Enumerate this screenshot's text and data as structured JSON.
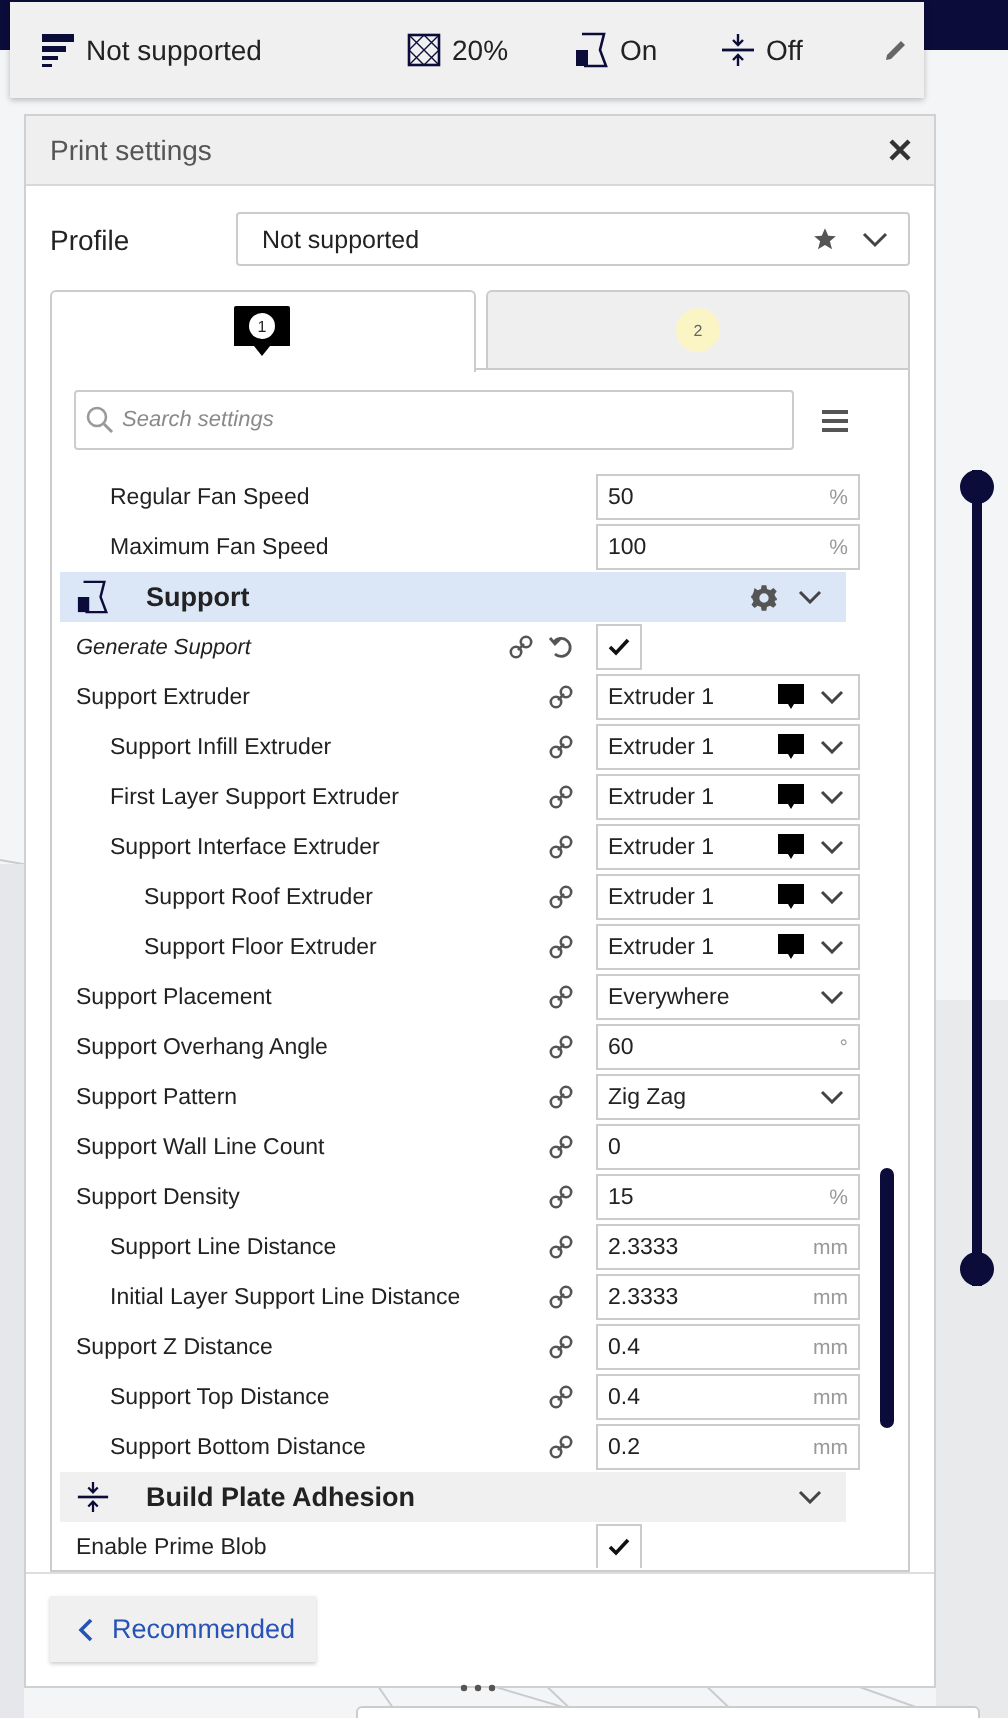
{
  "header": {
    "items": [
      {
        "kind": "profile",
        "label": "Not supported"
      },
      {
        "kind": "infill",
        "label": "20%"
      },
      {
        "kind": "support",
        "label": "On"
      },
      {
        "kind": "adhesion",
        "label": "Off"
      }
    ]
  },
  "print_settings": {
    "title": "Print settings",
    "profile": {
      "label": "Profile",
      "value": "Not supported"
    },
    "tabs": [
      {
        "label": "1",
        "selected": true,
        "color": "#000000"
      },
      {
        "label": "2",
        "selected": false,
        "color": "#fbf5c6"
      }
    ],
    "search": {
      "placeholder": "Search settings"
    },
    "continued_rows": [
      {
        "label": "Regular Fan Speed",
        "kind": "number",
        "value": "50",
        "unit": "%",
        "linked": false,
        "modified": false
      },
      {
        "label": "Maximum Fan Speed",
        "kind": "number",
        "value": "100",
        "unit": "%",
        "linked": false,
        "modified": false
      }
    ],
    "categories": [
      {
        "kind": "support",
        "title": "Support",
        "highlighted": true,
        "settings_button": true,
        "settings": [
          {
            "label": "Generate Support",
            "kind": "checkbox",
            "checked": true,
            "linked": true,
            "modified": true
          },
          {
            "label": "Support Extruder",
            "kind": "extruder",
            "value": "Extruder 1",
            "linked": true,
            "modified": false,
            "children": [
              {
                "label": "Support Infill Extruder",
                "kind": "extruder",
                "value": "Extruder 1",
                "linked": true,
                "modified": false
              },
              {
                "label": "First Layer Support Extruder",
                "kind": "extruder",
                "value": "Extruder 1",
                "linked": true,
                "modified": false
              },
              {
                "label": "Support Interface Extruder",
                "kind": "extruder",
                "value": "Extruder 1",
                "linked": true,
                "modified": false,
                "children": [
                  {
                    "label": "Support Roof Extruder",
                    "kind": "extruder",
                    "value": "Extruder 1",
                    "linked": true,
                    "modified": false
                  },
                  {
                    "label": "Support Floor Extruder",
                    "kind": "extruder",
                    "value": "Extruder 1",
                    "linked": true,
                    "modified": false
                  }
                ]
              }
            ]
          },
          {
            "label": "Support Placement",
            "kind": "select",
            "value": "Everywhere",
            "linked": true,
            "modified": false
          },
          {
            "label": "Support Overhang Angle",
            "kind": "number",
            "value": "60",
            "unit": "°",
            "linked": true,
            "modified": false
          },
          {
            "label": "Support Pattern",
            "kind": "select",
            "value": "Zig Zag",
            "linked": true,
            "modified": false
          },
          {
            "label": "Support Wall Line Count",
            "kind": "number",
            "value": "0",
            "linked": true,
            "modified": false
          },
          {
            "label": "Support Density",
            "kind": "number",
            "value": "15",
            "unit": "%",
            "linked": true,
            "modified": false,
            "children": [
              {
                "label": "Support Line Distance",
                "kind": "number",
                "value": "2.3333",
                "unit": "mm",
                "linked": true,
                "modified": false
              },
              {
                "label": "Initial Layer Support Line Distance",
                "kind": "number",
                "value": "2.3333",
                "unit": "mm",
                "linked": true,
                "modified": false
              }
            ]
          },
          {
            "label": "Support Z Distance",
            "kind": "number",
            "value": "0.4",
            "unit": "mm",
            "linked": true,
            "modified": false,
            "children": [
              {
                "label": "Support Top Distance",
                "kind": "number",
                "value": "0.4",
                "unit": "mm",
                "linked": true,
                "modified": false
              },
              {
                "label": "Support Bottom Distance",
                "kind": "number",
                "value": "0.2",
                "unit": "mm",
                "linked": true,
                "modified": false
              }
            ]
          }
        ]
      },
      {
        "kind": "adhesion",
        "title": "Build Plate Adhesion",
        "highlighted": false,
        "settings_button": false,
        "settings": [
          {
            "label": "Enable Prime Blob",
            "kind": "checkbox",
            "checked": true,
            "linked": false,
            "modified": false
          }
        ]
      }
    ],
    "footer_button": "Recommended"
  }
}
